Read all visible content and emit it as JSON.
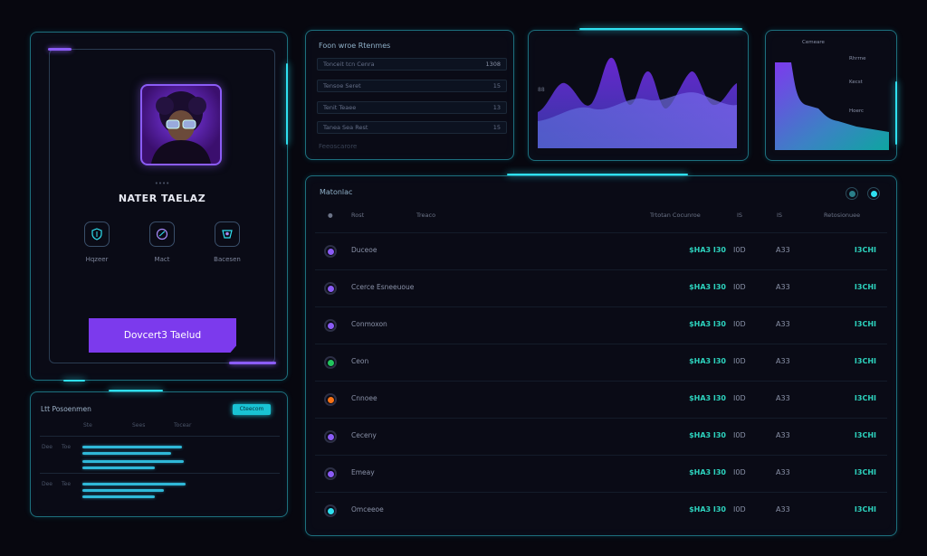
{
  "profile": {
    "role": "••••",
    "name": "NATER TAELAZ",
    "actions": [
      {
        "label": "Hqzeer",
        "icon": "shield-icon"
      },
      {
        "label": "Mact",
        "icon": "globe-icon"
      },
      {
        "label": "Bacesen",
        "icon": "badge-icon"
      }
    ],
    "primary_button": "Dovcert3 Taelud"
  },
  "list_panel": {
    "title": "Foon wroe Rtenmes",
    "rows": [
      {
        "label": "Tonceit tcn Cenra",
        "value": "1308"
      },
      {
        "label": "Tensoe Seret",
        "value": "15"
      },
      {
        "label": "Tenit Teaee",
        "value": "13"
      },
      {
        "label": "Tanea Sea Rest",
        "value": "15"
      }
    ],
    "footer": "Feeoscarore"
  },
  "wave_chart": {
    "y_label": "88"
  },
  "step_chart": {
    "legend": [
      "Cemeare",
      "Rhrrne",
      "Kecst",
      "Hoerc"
    ]
  },
  "mini_panel": {
    "title": "Ltt Posoenmen",
    "badge": "Cteecom",
    "headers": [
      "Ste",
      "Sees",
      "Tocear"
    ],
    "rows": [
      {
        "label": "Dee",
        "label2": "Toe"
      },
      {
        "label": "Dee",
        "label2": "Tee"
      }
    ]
  },
  "table": {
    "title": "Matonlac",
    "headers": {
      "col1": "Rost",
      "col2": "Treaco",
      "col3": "Trtotan Cocunroe",
      "col4": "IS",
      "col5": "IS",
      "col6": "Retosionuee"
    },
    "rows": [
      {
        "name": "Duceoe",
        "value": "$HA3 I30",
        "id": "I0D",
        "pct": "A33",
        "status": "I3CHI",
        "color": "#8b5cf6"
      },
      {
        "name": "Ccerce Esneeuoue",
        "value": "$HA3 I30",
        "id": "I0D",
        "pct": "A33",
        "status": "I3CHI",
        "color": "#8b5cf6"
      },
      {
        "name": "Conmoxon",
        "value": "$HA3 I30",
        "id": "I0D",
        "pct": "A33",
        "status": "I3CHI",
        "color": "#8b5cf6"
      },
      {
        "name": "Ceon",
        "value": "$HA3 I30",
        "id": "I0D",
        "pct": "A33",
        "status": "I3CHI",
        "color": "#22c55e"
      },
      {
        "name": "Cnnoee",
        "value": "$HA3 I30",
        "id": "I0D",
        "pct": "A33",
        "status": "I3CHI",
        "color": "#f97316"
      },
      {
        "name": "Ceceny",
        "value": "$HA3 I30",
        "id": "I0D",
        "pct": "A33",
        "status": "I3CHI",
        "color": "#8b5cf6"
      },
      {
        "name": "Emeay",
        "value": "$HA3 I30",
        "id": "I0D",
        "pct": "A33",
        "status": "I3CHI",
        "color": "#8b5cf6"
      },
      {
        "name": "Omceeoe",
        "value": "$HA3 I30",
        "id": "I0D",
        "pct": "A33",
        "status": "I3CHI",
        "color": "#2fe0f0"
      }
    ]
  },
  "colors": {
    "accent_purple": "#7c3aed",
    "accent_cyan": "#2fe0f0",
    "value_teal": "#2dd4bf"
  }
}
